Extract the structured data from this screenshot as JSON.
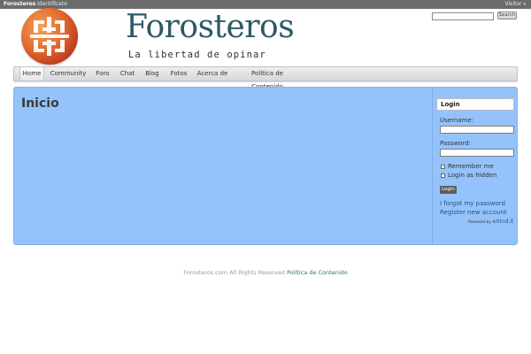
{
  "topbar": {
    "site": "Forosteros",
    "identify": "Identifícate",
    "visitor": "Visitor",
    "caret": "▾"
  },
  "header": {
    "title": "Forosteros",
    "tagline": "La libertad de opinar",
    "search_button": "Search",
    "search_value": ""
  },
  "nav": {
    "items": [
      {
        "label": "Home"
      },
      {
        "label": "Community"
      },
      {
        "label": "Foro"
      },
      {
        "label": "Chat"
      },
      {
        "label": "Blog"
      },
      {
        "label": "Fotos"
      },
      {
        "label": "Acerca de"
      },
      {
        "label": "Política de Contenido"
      }
    ],
    "active_index": 0
  },
  "main": {
    "page_title": "Inicio"
  },
  "login": {
    "heading": "Login",
    "username_label": "Username:",
    "username_value": "",
    "password_label": "Password:",
    "password_value": "",
    "remember_me": "Remember me",
    "login_hidden": "Login as hidden",
    "button": "Login",
    "forgot": "I forgot my password",
    "register": "Register new account",
    "powered_by": "Powered by",
    "powered_brand": "eXtnd.it"
  },
  "footer": {
    "text": "Forosteros.com All Rights Reserved",
    "link": "Política de Contenido"
  },
  "colors": {
    "main_bg": "#94c3fc",
    "brand": "#2c5a64",
    "logo_orange": "#e26a2c"
  }
}
